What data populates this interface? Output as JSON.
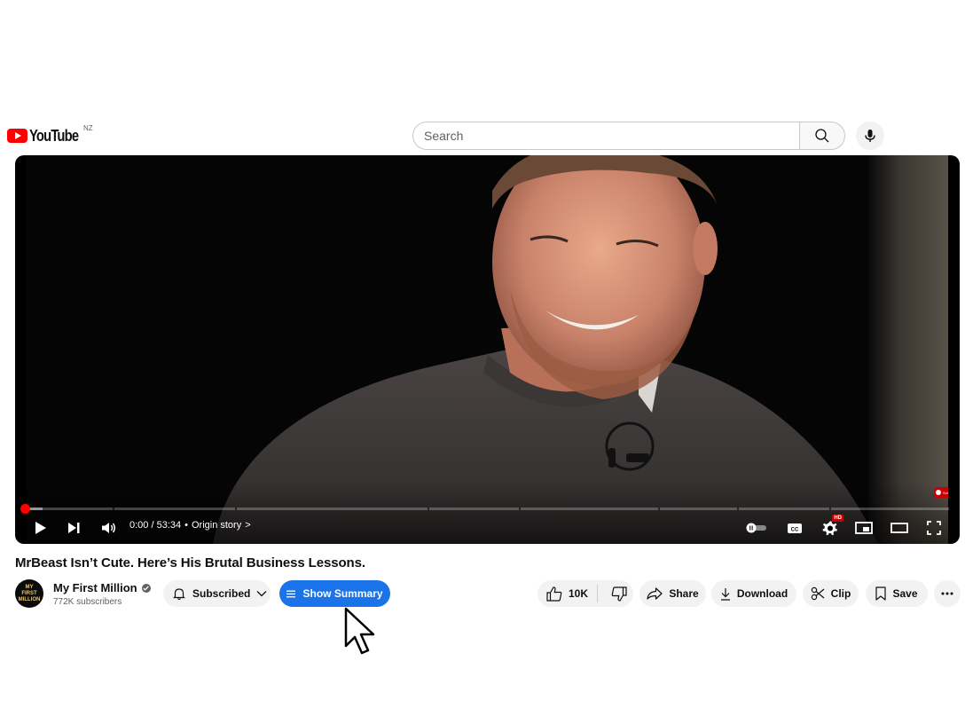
{
  "header": {
    "logo_text": "YouTube",
    "region": "NZ",
    "search_placeholder": "Search",
    "icons": {
      "search": "search-icon",
      "mic": "mic-icon"
    }
  },
  "player": {
    "time": "0:00 / 53:34",
    "chapter": "Origin story",
    "chapter_sep": "•",
    "chapter_arrow": ">",
    "hd_badge": "HD",
    "progress_fraction": 0.0,
    "loaded_fraction": 0.02,
    "icons": [
      "play-icon",
      "next-icon",
      "volume-icon",
      "autoplay-toggle-icon",
      "captions-icon",
      "settings-icon",
      "miniplayer-icon",
      "theater-icon",
      "fullscreen-icon"
    ]
  },
  "video": {
    "title": "MrBeast Isn’t Cute. Here’s His Brutal Business Lessons."
  },
  "channel": {
    "avatar_text": [
      "MY",
      "FIRST",
      "MILLION"
    ],
    "name": "My First Million",
    "subscribers": "772K subscribers"
  },
  "actions": {
    "subscribed": "Subscribed",
    "show_summary": "Show Summary",
    "likes": "10K",
    "share": "Share",
    "download": "Download",
    "clip": "Clip",
    "save": "Save"
  },
  "colors": {
    "brand_red": "#ff0000",
    "summary_blue": "#1a73e8",
    "pill_bg": "#f2f2f2",
    "text": "#0f0f0f",
    "secondary_text": "#606060"
  }
}
